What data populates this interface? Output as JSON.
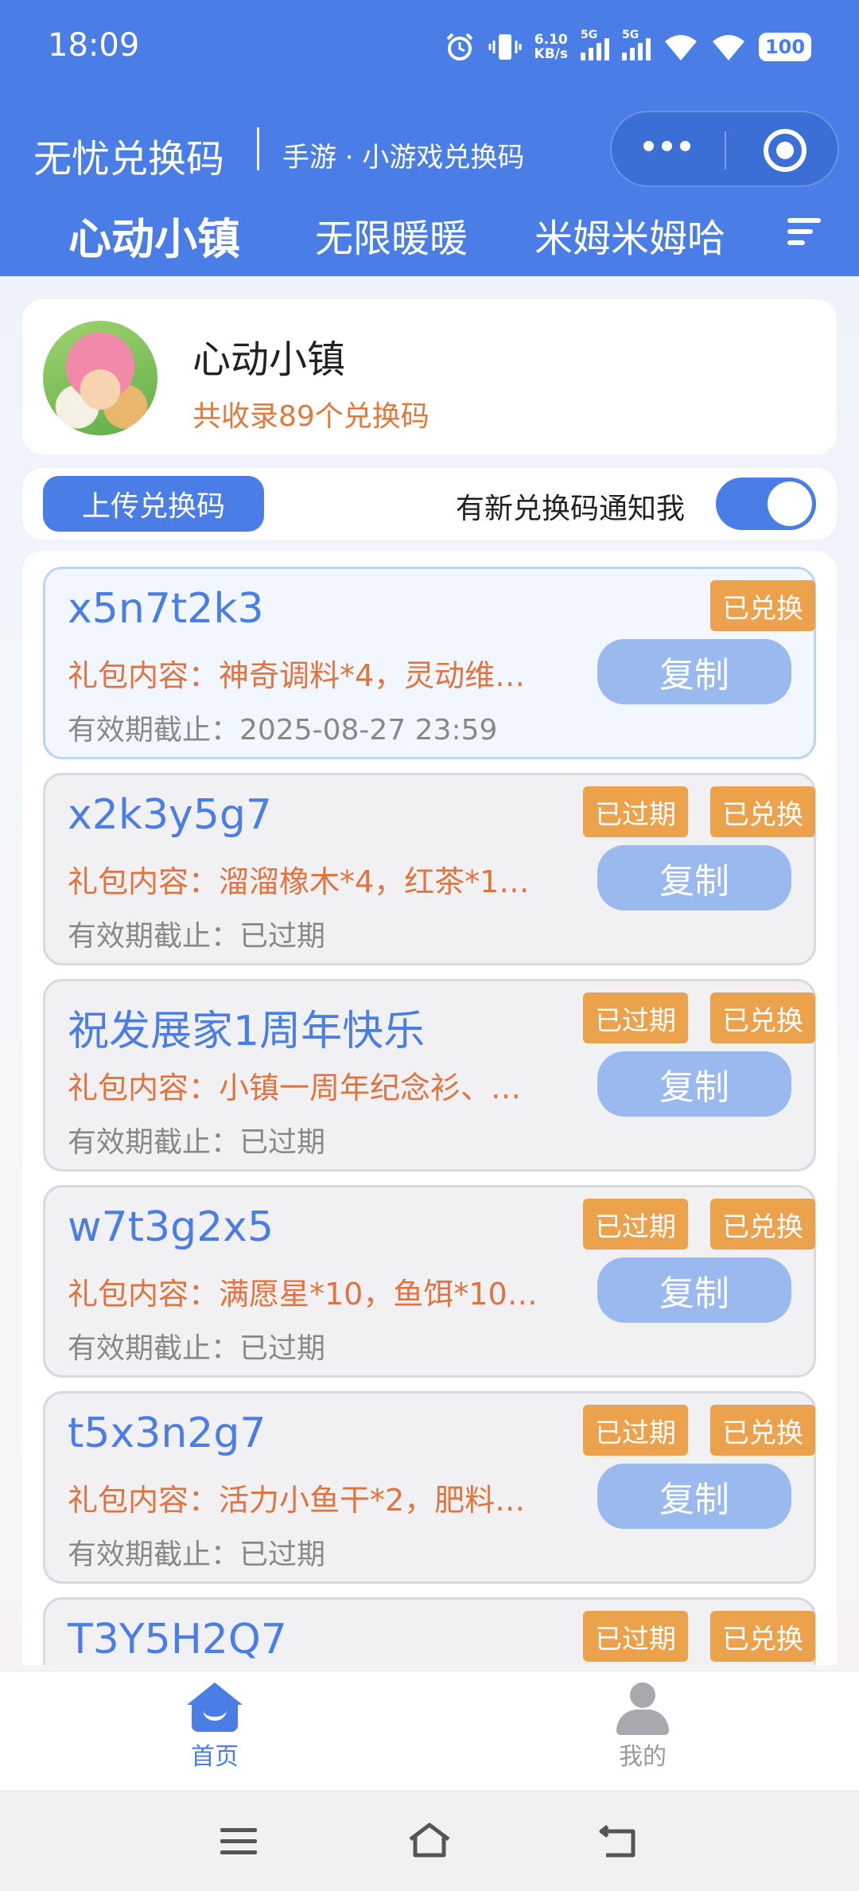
{
  "status_bar": {
    "time": "18:09",
    "net_speed_value": "6.10",
    "net_speed_unit": "KB/s",
    "signal1_label": "5G",
    "signal2_label": "5G",
    "battery": "100"
  },
  "app_bar": {
    "title": "无忧兑换码",
    "subtitle": "手游 · 小游戏兑换码"
  },
  "tabs": [
    {
      "label": "心动小镇",
      "active": true
    },
    {
      "label": "无限暖暖",
      "active": false
    },
    {
      "label": "米姆米姆哈",
      "active": false
    }
  ],
  "game": {
    "name": "心动小镇",
    "count_text": "共收录89个兑换码"
  },
  "actions": {
    "upload_label": "上传兑换码",
    "notify_label": "有新兑换码通知我",
    "notify_on": true
  },
  "codes": [
    {
      "code": "x5n7t2k3",
      "gift": "礼包内容：神奇调料*4，灵动维…",
      "expiry": "有效期截止：2025-08-27 23:59",
      "expired_badge": "",
      "redeemed_badge": "已兑换",
      "copy_label": "复制"
    },
    {
      "code": "x2k3y5g7",
      "gift": "礼包内容：溜溜橡木*4，红茶*1…",
      "expiry": "有效期截止：已过期",
      "expired_badge": "已过期",
      "redeemed_badge": "已兑换",
      "copy_label": "复制"
    },
    {
      "code": "祝发展家1周年快乐",
      "gift": "礼包内容：小镇一周年纪念衫、…",
      "expiry": "有效期截止：已过期",
      "expired_badge": "已过期",
      "redeemed_badge": "已兑换",
      "copy_label": "复制"
    },
    {
      "code": "w7t3g2x5",
      "gift": "礼包内容：满愿星*10，鱼饵*10…",
      "expiry": "有效期截止：已过期",
      "expired_badge": "已过期",
      "redeemed_badge": "已兑换",
      "copy_label": "复制"
    },
    {
      "code": "t5x3n2g7",
      "gift": "礼包内容：活力小鱼干*2，肥料…",
      "expiry": "有效期截止：已过期",
      "expired_badge": "已过期",
      "redeemed_badge": "已兑换",
      "copy_label": "复制"
    },
    {
      "code": "T3Y5H2Q7",
      "gift": "",
      "expiry": "",
      "expired_badge": "已过期",
      "redeemed_badge": "已兑换",
      "copy_label": ""
    }
  ],
  "bottom_nav": {
    "home_label": "首页",
    "me_label": "我的"
  },
  "colors": {
    "primary": "#4a7ee6",
    "badge": "#eca24c",
    "gift_text": "#e2733e",
    "copy_button": "#9ab9ef"
  }
}
